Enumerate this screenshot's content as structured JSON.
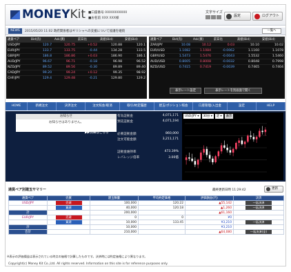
{
  "header": {
    "logo_main": "MONEY",
    "logo_sub": "Kit",
    "user_line1": "■口座番号 00000000000",
    "user_line2": "■お名前 XXX XXX様",
    "font_size_label": "文字サイズ",
    "settings_label": "設定",
    "logout_label": "ログアウト"
  },
  "news": {
    "label": "NEWS",
    "text": "2015/05/20 11:02 政府関係者はギリシャへの支援について協議を継続",
    "list_button": "一覧へ"
  },
  "rates_left": {
    "headers": [
      "通貨ペア",
      "Bid(売)",
      "Ask(買)",
      "前日比",
      "高値(Bid)",
      "安値(Bid)"
    ],
    "rows": [
      {
        "pair": "USD/JPY",
        "bid": "120.7",
        "ask": "120.75",
        "chg": "+0.52",
        "high": "120.88",
        "low": "120.1"
      },
      {
        "pair": "EUR/JPY",
        "bid": "133.7",
        "ask": "133.75",
        "chg": "-0.44",
        "high": "134.28",
        "low": "133.5"
      },
      {
        "pair": "GBP/JPY",
        "bid": "186.8",
        "ask": "186.86",
        "chg": "+0.03",
        "high": "186.90",
        "low": "186.1"
      },
      {
        "pair": "AUD/JPY",
        "bid": "96.67",
        "ask": "96.71",
        "chg": "-0.18",
        "high": "96.98",
        "low": "96.52"
      },
      {
        "pair": "NZD/JPY",
        "bid": "89.52",
        "ask": "89.56",
        "chg": "-0.30",
        "high": "89.89",
        "low": "89.40"
      },
      {
        "pair": "CAD/JPY",
        "bid": "99.20",
        "ask": "99.24",
        "chg": "+0.12",
        "high": "99.35",
        "low": "98.92"
      },
      {
        "pair": "CHF/JPY",
        "bid": "129.4",
        "ask": "129.48",
        "chg": "-0.21",
        "high": "129.80",
        "low": "129.2"
      }
    ]
  },
  "rates_right": {
    "headers": [
      "通貨ペア",
      "Bid(売)",
      "Ask(買)",
      "前日比",
      "高値(Bid)",
      "安値(Bid)"
    ],
    "rows": [
      {
        "pair": "ZAR/JPY",
        "bid": "10.08",
        "ask": "10.12",
        "chg": "0.03",
        "high": "10.10",
        "low": "10.02"
      },
      {
        "pair": "EUR/USD",
        "bid": "1.1082",
        "ask": "1.1084",
        "chg": "-0.0062",
        "high": "1.1160",
        "low": "1.1078"
      },
      {
        "pair": "GBP/USD",
        "bid": "1.5473",
        "ask": "1.5476",
        "chg": "-0.0043",
        "high": "1.5532",
        "low": "1.5460"
      },
      {
        "pair": "AUD/USD",
        "bid": "0.8005",
        "ask": "0.8008",
        "chg": "-0.0032",
        "high": "0.8048",
        "low": "0.7998"
      },
      {
        "pair": "NZD/USD",
        "bid": "0.7415",
        "ask": "0.7419",
        "chg": "-0.0039",
        "high": "0.7465",
        "low": "0.7404"
      }
    ],
    "btn_settings": "表示レート設定",
    "btn_popup": "表示レートを別画面で開く"
  },
  "nav": [
    "HOME",
    "新規注文",
    "決済注文",
    "注文照会/取消",
    "取引/約定履歴",
    "建玉/ポジション照会",
    "口座管理/入出金",
    "設定",
    "HELP"
  ],
  "messages": {
    "title": "お知らせ",
    "text": "お知らせはありません。",
    "detail": "▶▶詳細はこちら"
  },
  "account": {
    "rows": [
      {
        "label": "有効証拠金",
        "value": "4,071,171"
      },
      {
        "label": "預託証拠金",
        "value": "4,071,194"
      },
      {
        "label": "必要証拠金額",
        "value": "860,000"
      },
      {
        "label": "注文可能金額",
        "value": "3,211,171"
      },
      {
        "label": "証拠金維持率",
        "value": "473.39%"
      },
      {
        "label": "レバレッジ倍率",
        "value": "3.00倍"
      }
    ]
  },
  "chart_controls": {
    "pair": "USD/JPY",
    "interval": "30分",
    "type": "足",
    "display_btn": "表示"
  },
  "chart_data": {
    "type": "candlestick",
    "series": [
      {
        "o": 119.5,
        "h": 119.7,
        "l": 119.3,
        "c": 119.6
      },
      {
        "o": 119.6,
        "h": 119.8,
        "l": 119.45,
        "c": 119.55
      },
      {
        "o": 119.55,
        "h": 119.75,
        "l": 119.4,
        "c": 119.45
      },
      {
        "o": 119.45,
        "h": 119.6,
        "l": 119.2,
        "c": 119.3
      },
      {
        "o": 119.3,
        "h": 119.55,
        "l": 119.15,
        "c": 119.5
      },
      {
        "o": 119.5,
        "h": 119.9,
        "l": 119.4,
        "c": 119.8
      },
      {
        "o": 119.8,
        "h": 120.1,
        "l": 119.7,
        "c": 119.95
      },
      {
        "o": 119.95,
        "h": 120.05,
        "l": 119.6,
        "c": 119.7
      },
      {
        "o": 119.7,
        "h": 119.85,
        "l": 119.4,
        "c": 119.55
      },
      {
        "o": 119.55,
        "h": 119.65,
        "l": 119.3,
        "c": 119.4
      },
      {
        "o": 119.4,
        "h": 119.7,
        "l": 119.35,
        "c": 119.65
      },
      {
        "o": 119.65,
        "h": 119.9,
        "l": 119.55,
        "c": 119.85
      },
      {
        "o": 119.85,
        "h": 120.2,
        "l": 119.75,
        "c": 120.1
      },
      {
        "o": 120.1,
        "h": 120.3,
        "l": 119.95,
        "c": 120.0
      },
      {
        "o": 120.0,
        "h": 120.15,
        "l": 119.8,
        "c": 119.9
      },
      {
        "o": 119.9,
        "h": 120.05,
        "l": 119.7,
        "c": 119.8
      },
      {
        "o": 119.8,
        "h": 120.0,
        "l": 119.65,
        "c": 119.95
      },
      {
        "o": 119.95,
        "h": 120.25,
        "l": 119.9,
        "c": 120.2
      },
      {
        "o": 120.2,
        "h": 120.4,
        "l": 120.05,
        "c": 120.3
      },
      {
        "o": 120.3,
        "h": 120.45,
        "l": 120.1,
        "c": 120.15
      },
      {
        "o": 120.15,
        "h": 120.3,
        "l": 120.0,
        "c": 120.25
      },
      {
        "o": 120.25,
        "h": 120.55,
        "l": 120.2,
        "c": 120.5
      },
      {
        "o": 120.5,
        "h": 120.7,
        "l": 120.35,
        "c": 120.45
      },
      {
        "o": 120.45,
        "h": 120.6,
        "l": 120.25,
        "c": 120.35
      },
      {
        "o": 120.35,
        "h": 120.5,
        "l": 120.2,
        "c": 120.45
      },
      {
        "o": 120.45,
        "h": 120.8,
        "l": 120.4,
        "c": 120.7
      },
      {
        "o": 120.7,
        "h": 120.9,
        "l": 120.55,
        "c": 120.65
      },
      {
        "o": 120.65,
        "h": 120.85,
        "l": 120.5,
        "c": 120.75
      }
    ],
    "ylim": [
      119.0,
      121.0
    ],
    "up_color": "#ff4466",
    "down_color": "#ffffff"
  },
  "summary": {
    "title": "通貨ペア別建玉サマリー",
    "updated": "最終更新日時 11:29:42",
    "refresh": "更新",
    "headers": [
      "通貨ペア",
      "売買",
      "建玉数量",
      "平均約定価格",
      "評価損益(円)",
      "決済"
    ],
    "rows": [
      {
        "pair": "USD/JPY",
        "side": "売建",
        "qty": "100,000",
        "avg": "120.22",
        "pl": "▲55,142",
        "pl_neg": true,
        "act": "一括決済"
      },
      {
        "pair": "",
        "side": "買建",
        "qty": "40,000",
        "avg": "120.18",
        "pl": "▲1,260",
        "pl_neg": true,
        "act": "一括決済"
      },
      {
        "pair": "計",
        "side": "",
        "qty": "200,000",
        "avg": "",
        "pl": "▲61,160",
        "pl_neg": true,
        "act": ""
      },
      {
        "pair": "EUR/JPY",
        "side": "売建",
        "qty": "0",
        "avg": "0",
        "pl": "¥0",
        "pl_neg": false,
        "act": ""
      },
      {
        "pair": "",
        "side": "買建",
        "qty": "10,000",
        "avg": "133.45",
        "pl": "¥3,210",
        "pl_neg": false,
        "act": "一括決済"
      },
      {
        "pair": "計",
        "side": "",
        "qty": "10,000",
        "avg": "",
        "pl": "¥3,210",
        "pl_neg": false,
        "act": ""
      },
      {
        "pair": "合計",
        "side": "",
        "qty": "210,000",
        "avg": "",
        "pl": "▲64,080",
        "pl_neg": true,
        "act": "一括決済(全)"
      }
    ]
  },
  "note": "※表示の評価損益は表示されている時点の価格で計算したものです。決済時には約定価格により異なります。",
  "copyright": "Copyright(c) Money Kit Co.,Ltd. All rights reserved. Information on this site is for reference purposes only."
}
